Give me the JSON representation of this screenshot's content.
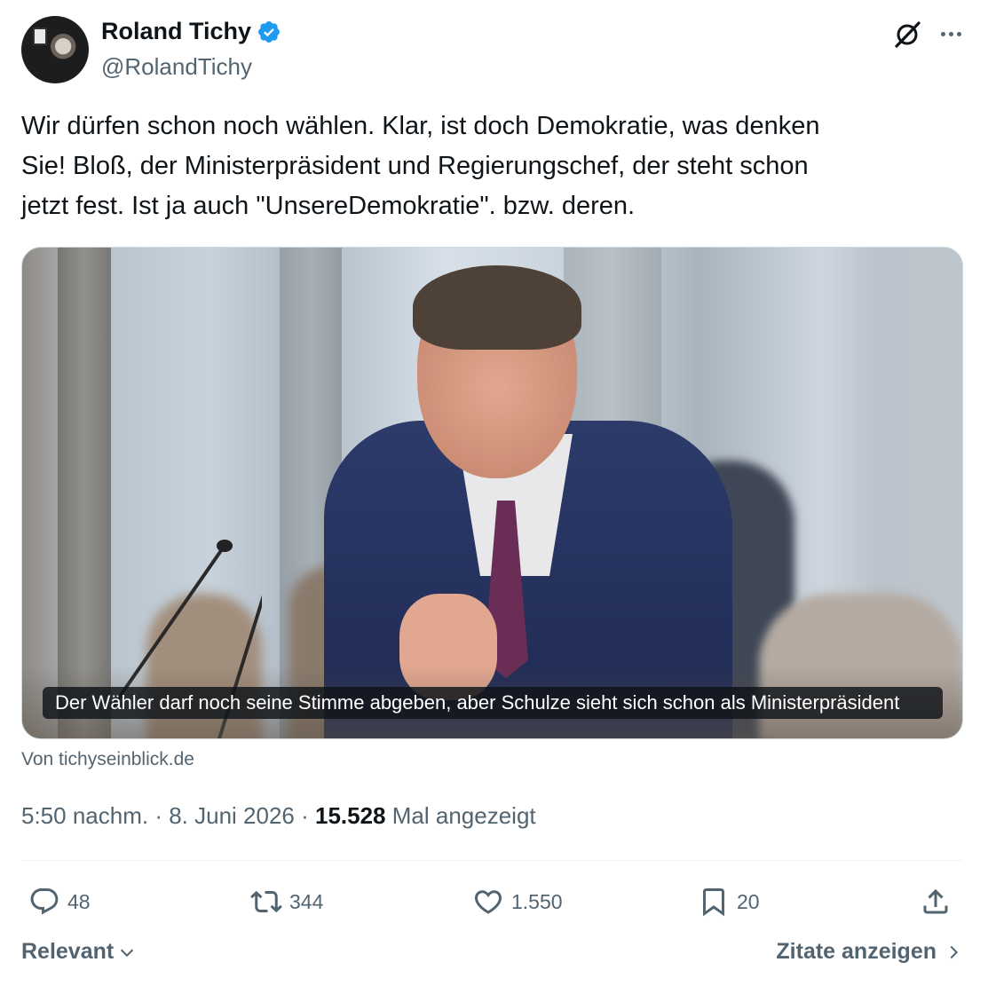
{
  "author": {
    "name": "Roland Tichy",
    "handle": "@RolandTichy",
    "verified": true
  },
  "tweet": {
    "lines": [
      "Wir dürfen schon noch wählen. Klar, ist doch Demokratie, was denken",
      "Sie! Bloß, der Ministerpräsident und Regierungschef, der steht schon",
      "jetzt fest. Ist ja auch \"UnsereDemokratie\". bzw. deren."
    ]
  },
  "link_card": {
    "caption": "Der Wähler darf noch seine Stimme abgeben, aber Schulze sieht sich schon als Ministerpräsident",
    "source": "Von tichyseinblick.de"
  },
  "meta": {
    "time": "5:50 nachm.",
    "separator": " · ",
    "date": "8. Juni 2026",
    "views": "15.528",
    "views_label": "Mal angezeigt"
  },
  "actions": {
    "replies": "48",
    "reposts": "344",
    "likes": "1.550",
    "bookmarks": "20"
  },
  "footer": {
    "sort_label": "Relevant",
    "quotes_label": "Zitate anzeigen"
  },
  "colors": {
    "text_primary": "#0f1419",
    "text_secondary": "#536471",
    "verified_blue": "#1d9bf0",
    "divider": "#eff3f4"
  },
  "icons": [
    "verified-badge-icon",
    "grok-icon",
    "more-icon",
    "reply-icon",
    "repost-icon",
    "like-icon",
    "bookmark-icon",
    "share-icon",
    "chevron-down-icon",
    "chevron-right-icon"
  ]
}
